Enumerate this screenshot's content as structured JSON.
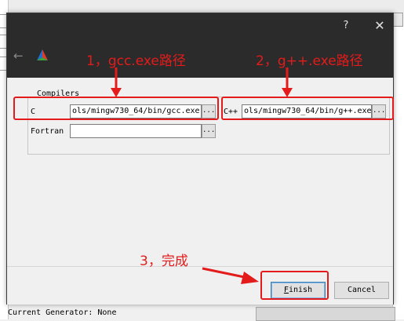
{
  "background": {
    "status_text": "Current Generator: None"
  },
  "dialog": {
    "help_label": "?",
    "close_label": "✕",
    "back_icon": "back-arrow-icon",
    "logo_icon": "cmake-logo-icon",
    "compilers_group_title": "Compilers",
    "c_label": "C",
    "c_value": "ols/mingw730_64/bin/gcc.exe",
    "cxx_label": "C++",
    "cxx_value": "ols/mingw730_64/bin/g++.exe",
    "fortran_label": "Fortran",
    "fortran_value": "",
    "browse_label": "...",
    "finish_label": "Finish",
    "cancel_label": "Cancel"
  },
  "annotations": {
    "note1": "1，gcc.exe路径",
    "note2": "2，g++.exe路径",
    "note3": "3，完成",
    "color": "#e41b1b"
  }
}
